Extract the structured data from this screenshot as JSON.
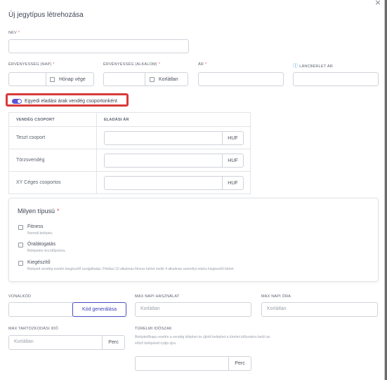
{
  "dialog": {
    "title": "Új jegytípus létrehozása",
    "close_glyph": "×"
  },
  "fields": {
    "name_label": "NÉV",
    "validity_days_label": "ÉRVÉNYESSÉG (NAP)",
    "month_end_label": "Hónap vége",
    "validity_uses_label": "ÉRVÉNYESSÉG (ALKALOM)",
    "unlimited_label": "Korlátlan",
    "price_label": "ÁR",
    "chain_price_label": "LÁNCBÉRLET ÁR",
    "required_mark": "*"
  },
  "toggle": {
    "label": "Egyedi eladási árak vendég csoportonként",
    "on": true
  },
  "price_table": {
    "headers": [
      "VENDÉG CSOPORT",
      "ELADÁSI ÁR"
    ],
    "currency": "HUF",
    "rows": [
      "Teszt csoport",
      "Törzsvendég",
      "XY Céges csoportos"
    ]
  },
  "type_section": {
    "title": "Milyen típusú",
    "options": [
      {
        "label": "Fitness",
        "desc": "Normál belépés."
      },
      {
        "label": "Óralátogatás",
        "desc": "Belépetés óra időpontra."
      },
      {
        "label": "Kiegészítő",
        "desc": "Belépett vendég esetén kiegészítő szolgáltatás. Például 10 alkalmas fitness bérlet mellé 4 alkalmas személyi edzés kiegészítő bérlet."
      }
    ]
  },
  "bottom": {
    "barcode_label": "VONALKÓD",
    "generate_button": "Kód generálása",
    "max_daily_use_label": "MAX NAPI HASZNÁLAT",
    "max_daily_use_placeholder": "Korlátlan",
    "max_daily_hours_label": "MAX NAPI ÓRA",
    "max_daily_hours_placeholder": "Korlátlan",
    "max_stay_label": "MAX TARTÓZKODÁSI IDŐ",
    "max_stay_placeholder": "Korlátlan",
    "minute_unit": "Perc",
    "grace_label": "TÜRELMI IDŐSZAK",
    "grace_desc": "Beléptetőkapu esetén a vendég kiléphet és újbóli beléphet a türelmi időszakon belül az előző belépését nyitja újra."
  },
  "colors": {
    "accent": "#5a54d8",
    "highlight_border": "#d93a3a",
    "required": "#e05252",
    "info": "#3aa6d8"
  }
}
